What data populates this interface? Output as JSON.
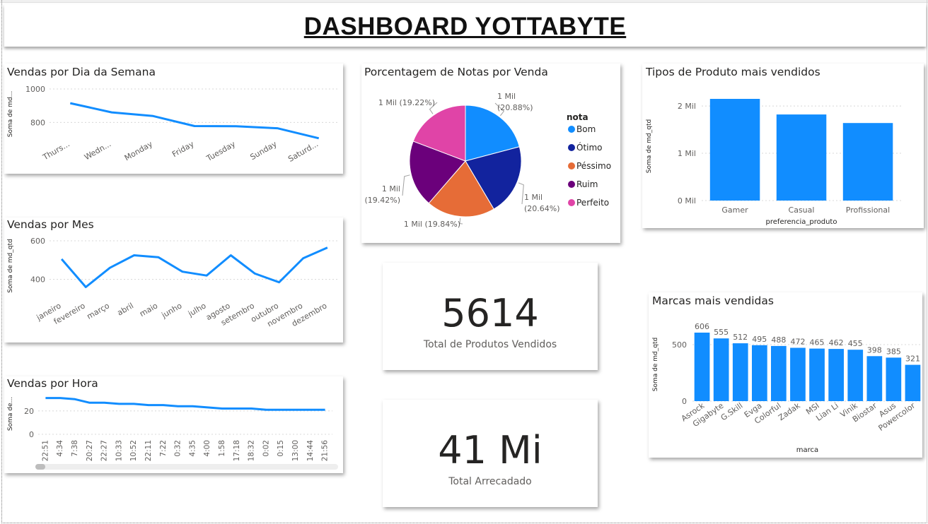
{
  "header": {
    "title": "DASHBOARD YOTTABYTE"
  },
  "kpis": {
    "produtos": {
      "value": "5614",
      "label": "Total de Produtos Vendidos"
    },
    "arrecadado": {
      "value": "41 Mi",
      "label": "Total Arrecadado"
    }
  },
  "chart_data": [
    {
      "id": "dia",
      "type": "line",
      "title": "Vendas por Dia da Semana",
      "ylabel": "Soma de md...",
      "categories": [
        "Thurs...",
        "Wedn...",
        "Monday",
        "Friday",
        "Tuesday",
        "Sunday",
        "Saturd..."
      ],
      "values": [
        915,
        860,
        838,
        778,
        777,
        765,
        705
      ],
      "yticks": [
        800,
        1000
      ],
      "ylim": [
        700,
        1000
      ],
      "color": "#118DFF"
    },
    {
      "id": "mes",
      "type": "line",
      "title": "Vendas por Mes",
      "ylabel": "Soma de md_qtd",
      "categories": [
        "janeiro",
        "fevereiro",
        "março",
        "abril",
        "maio",
        "junho",
        "julho",
        "agosto",
        "setembro",
        "outubro",
        "novembro",
        "dezembro"
      ],
      "values": [
        505,
        360,
        460,
        525,
        515,
        440,
        420,
        525,
        430,
        385,
        510,
        565
      ],
      "yticks": [
        400,
        600
      ],
      "ylim": [
        340,
        600
      ],
      "color": "#118DFF"
    },
    {
      "id": "hora",
      "type": "line",
      "title": "Vendas por Hora",
      "ylabel": "Soma de...",
      "categories": [
        "22:51",
        "4:34",
        "7:38",
        "20:27",
        "22:27",
        "10:33",
        "10:52",
        "22:11",
        "7:22",
        "0:32",
        "4:35",
        "4:00",
        "1:58",
        "17:18",
        "18:32",
        "0:02",
        "0:15",
        "13:00",
        "14:44",
        "21:56"
      ],
      "values": [
        31,
        31,
        30,
        27,
        27,
        26,
        26,
        25,
        25,
        24,
        24,
        23,
        22,
        22,
        22,
        21,
        21,
        21,
        21,
        21
      ],
      "yticks": [
        0,
        20
      ],
      "ylim": [
        0,
        35
      ],
      "color": "#118DFF"
    },
    {
      "id": "notas",
      "type": "pie",
      "title": "Porcentagem de Notas por Venda",
      "legend_title": "nota",
      "series": [
        {
          "name": "Bom",
          "value": 20.88,
          "label1": "1 Mil",
          "label2": "(20.88%)",
          "color": "#118DFF"
        },
        {
          "name": "Ótimo",
          "value": 20.64,
          "label1": "1 Mil",
          "label2": "(20.64%)",
          "color": "#12239E"
        },
        {
          "name": "Péssimo",
          "value": 19.84,
          "label1": "1 Mil (19.84%)",
          "label2": "",
          "color": "#E66C37"
        },
        {
          "name": "Ruim",
          "value": 19.42,
          "label1": "1 Mil",
          "label2": "(19.42%)",
          "color": "#6B007B"
        },
        {
          "name": "Perfeito",
          "value": 19.22,
          "label1": "1 Mil (19.22%)",
          "label2": "",
          "color": "#E044A7"
        }
      ]
    },
    {
      "id": "tipos",
      "type": "bar",
      "title": "Tipos de Produto mais vendidos",
      "xlabel": "preferencia_produto",
      "ylabel": "Soma de md_qtd",
      "categories": [
        "Gamer",
        "Casual",
        "Profissional"
      ],
      "values": [
        2.15,
        1.82,
        1.64
      ],
      "yticks": [
        0,
        1,
        2
      ],
      "ytick_labels": [
        "0 Mil",
        "1 Mil",
        "2 Mil"
      ],
      "ylim": [
        0,
        2.3
      ],
      "color": "#118DFF"
    },
    {
      "id": "marcas",
      "type": "bar",
      "title": "Marcas mais vendidas",
      "xlabel": "marca",
      "ylabel": "Soma de md_qtd",
      "categories": [
        "Asrock",
        "Gigabyte",
        "G.Skill",
        "Evga",
        "Colorful",
        "Zadak",
        "MSI",
        "Lian Li",
        "Vinik",
        "Biostar",
        "Asus",
        "Powercolor"
      ],
      "values": [
        606,
        555,
        512,
        495,
        488,
        472,
        465,
        462,
        455,
        398,
        385,
        321
      ],
      "yticks": [
        0,
        500
      ],
      "ylim": [
        0,
        650
      ],
      "color": "#118DFF"
    }
  ]
}
